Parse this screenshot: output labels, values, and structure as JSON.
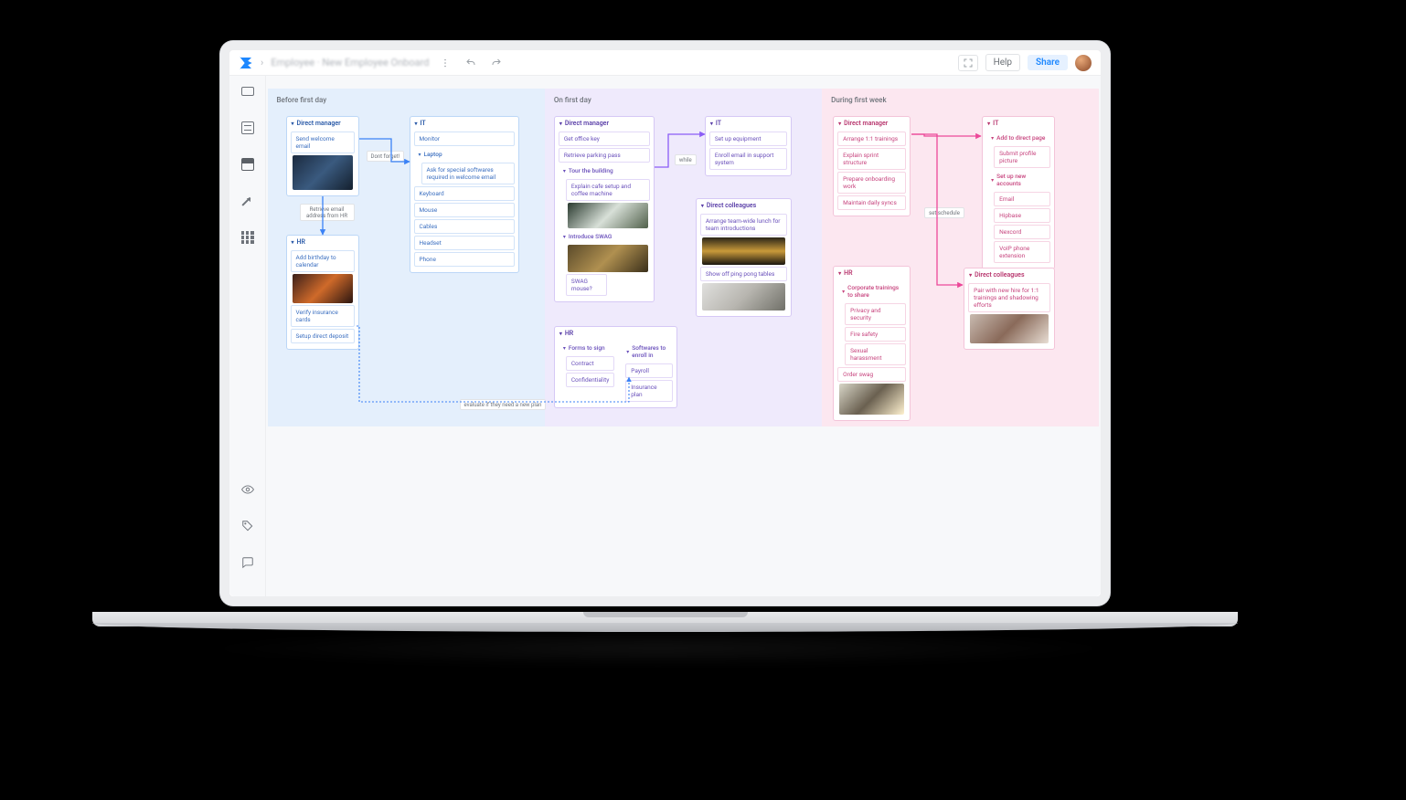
{
  "header": {
    "doc_title": "Employee · New Employee Onboard",
    "help": "Help",
    "share": "Share"
  },
  "columns": {
    "before": "Before first day",
    "onday": "On first day",
    "week": "During first week"
  },
  "labels": {
    "dont_forget": "Dont forget!",
    "retrieve_addr": "Retrieve email address from HR",
    "evaluate_plan": "evaluate if they need a new plan",
    "while": "while",
    "set_schedule": "set schedule"
  },
  "before": {
    "dm": {
      "title": "Direct manager",
      "item1": "Send welcome email"
    },
    "hr": {
      "title": "HR",
      "item1": "Add birthday to calendar",
      "item2": "Verify insurance cards",
      "item3": "Setup direct deposit"
    },
    "it": {
      "title": "IT",
      "item1": "Monitor",
      "laptop": "Laptop",
      "laptop_sub": "Ask for special softwares required in welcome email",
      "item3": "Keyboard",
      "item4": "Mouse",
      "item5": "Cables",
      "item6": "Headset",
      "item7": "Phone"
    }
  },
  "onday": {
    "dm": {
      "title": "Direct manager",
      "item1": "Get office key",
      "item2": "Retrieve parking pass",
      "tour": "Tour the building",
      "tour_sub1": "Explain cafe setup and coffee machine",
      "intro": "Introduce SWAG",
      "swag_mouse": "SWAG mouse?"
    },
    "it": {
      "title": "IT",
      "item1": "Set up equipment",
      "item2": "Enroll email in support system"
    },
    "dc": {
      "title": "Direct colleagues",
      "item1": "Arrange team-wide lunch for team introductions",
      "item2": "Show off ping pong tables"
    },
    "hr": {
      "title": "HR",
      "forms": "Forms to sign",
      "forms_sub1": "Contract",
      "forms_sub2": "Confidentiality",
      "sw": "Softwares to enroll in",
      "sw_sub1": "Payroll",
      "sw_sub2": "Insurance plan"
    }
  },
  "week": {
    "dm": {
      "title": "Direct manager",
      "item1": "Arrange 1:1 trainings",
      "item2": "Explain sprint structure",
      "item3": "Prepare onboarding work",
      "item4": "Maintain daily syncs"
    },
    "it": {
      "title": "IT",
      "addto": "Add to direct page",
      "addto_sub": "Submit profile picture",
      "accounts": "Set up new accounts",
      "acc1": "Email",
      "acc2": "Hipbase",
      "acc3": "Nexcord",
      "acc4": "VoIP phone extension"
    },
    "hr": {
      "title": "HR",
      "trainings": "Corporate trainings to share",
      "t1": "Privacy and security",
      "t2": "Fire safety",
      "t3": "Sexual harassment",
      "swag": "Order swag"
    },
    "dc": {
      "title": "Direct colleagues",
      "item1": "Pair with new hire for 1:1 trainings and shadowing efforts"
    }
  }
}
